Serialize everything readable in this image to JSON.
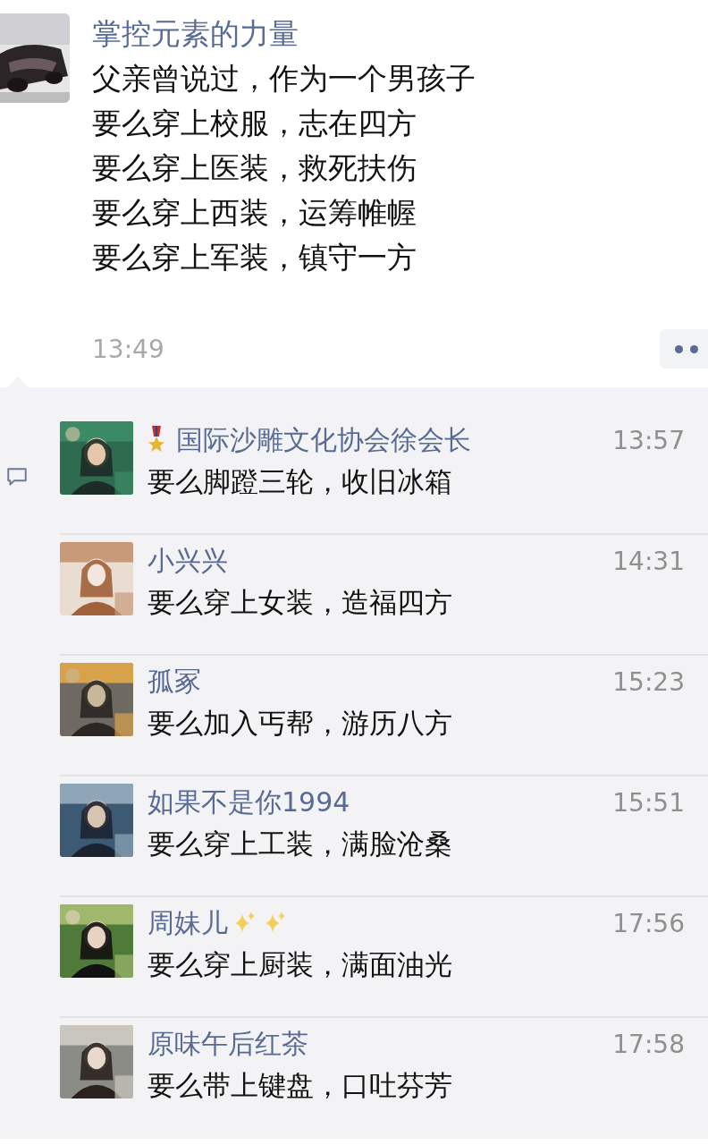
{
  "post": {
    "avatar": {
      "kind": "picture"
    },
    "author": "掌控元素的力量",
    "lines": [
      "父亲曾说过，作为一个男孩子",
      "要么穿上校服，志在四方",
      "要么穿上医装，救死扶伤",
      "要么穿上西装，运筹帷幄",
      "要么穿上军装，镇守一方"
    ],
    "time": "13:49"
  },
  "comments": [
    {
      "name": "国际沙雕文化协会徐会长",
      "kind": "medal",
      "time": "13:57",
      "text": "要么脚蹬三轮，收旧冰箱"
    },
    {
      "name": "小兴兴",
      "time": "14:31",
      "text": "要么穿上女装，造福四方"
    },
    {
      "name": "孤冢",
      "time": "15:23",
      "text": "要么加入丐帮，游历八方"
    },
    {
      "name": "如果不是你1994",
      "time": "15:51",
      "text": "要么穿上工装，满脸沧桑"
    },
    {
      "name": "周妹儿",
      "kind": "sparkles",
      "time": "17:56",
      "text": "要么穿上厨装，满面油光"
    },
    {
      "name": "原味午后红茶",
      "time": "17:58",
      "text": "要么带上键盘，口吐芬芳"
    }
  ]
}
